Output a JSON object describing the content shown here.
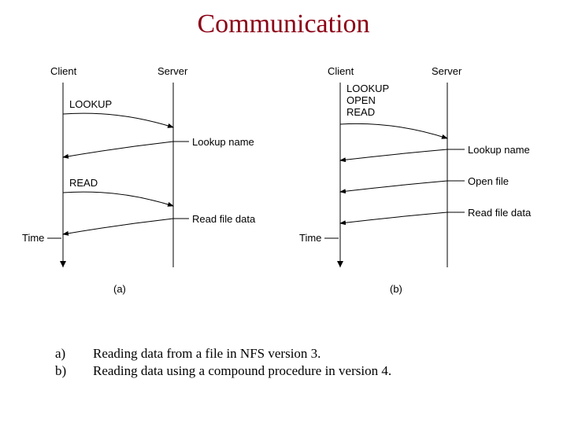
{
  "title": "Communication",
  "diagramA": {
    "client": "Client",
    "server": "Server",
    "op1": "LOOKUP",
    "resp1": "Lookup name",
    "op2": "READ",
    "resp2": "Read file data",
    "time": "Time",
    "sub": "(a)"
  },
  "diagramB": {
    "client": "Client",
    "server": "Server",
    "compound": "LOOKUP\nOPEN\nREAD",
    "resp1": "Lookup name",
    "resp2": "Open file",
    "resp3": "Read file data",
    "time": "Time",
    "sub": "(b)"
  },
  "captions": {
    "a_letter": "a)",
    "a_text": "Reading data from a file in NFS version 3.",
    "b_letter": "b)",
    "b_text": "Reading data using a compound procedure in version 4."
  }
}
